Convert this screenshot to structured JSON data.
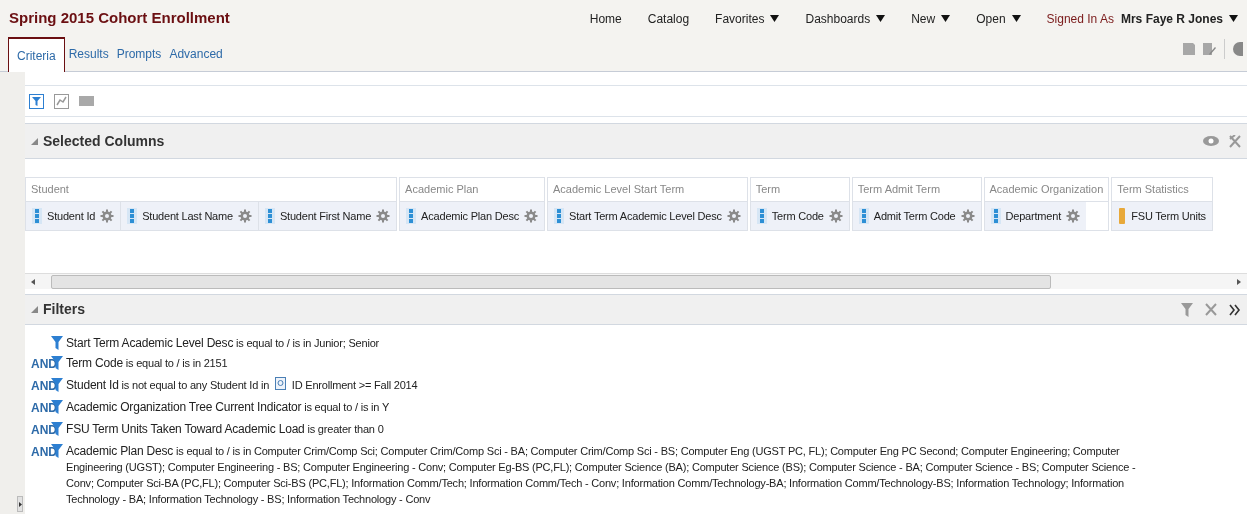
{
  "header": {
    "title": "Spring 2015 Cohort Enrollment",
    "nav": [
      {
        "label": "Home",
        "has_menu": false
      },
      {
        "label": "Catalog",
        "has_menu": false
      },
      {
        "label": "Favorites",
        "has_menu": true
      },
      {
        "label": "Dashboards",
        "has_menu": true
      },
      {
        "label": "New",
        "has_menu": true
      },
      {
        "label": "Open",
        "has_menu": true
      }
    ],
    "signed_in_label": "Signed In As",
    "user": "Mrs Faye R Jones"
  },
  "tabs": [
    {
      "label": "Criteria",
      "selected": true
    },
    {
      "label": "Results",
      "selected": false
    },
    {
      "label": "Prompts",
      "selected": false
    },
    {
      "label": "Advanced",
      "selected": false
    }
  ],
  "selected_columns": {
    "title": "Selected Columns",
    "expanded": true,
    "groups": [
      {
        "name": "Student",
        "columns": [
          {
            "name": "Student Id",
            "kind": "attribute"
          },
          {
            "name": "Student Last Name",
            "kind": "attribute"
          },
          {
            "name": "Student First Name",
            "kind": "attribute"
          }
        ]
      },
      {
        "name": "Academic Plan",
        "columns": [
          {
            "name": "Academic Plan Desc",
            "kind": "attribute"
          }
        ]
      },
      {
        "name": "Academic Level Start Term",
        "columns": [
          {
            "name": "Start Term Academic Level Desc",
            "kind": "attribute"
          }
        ]
      },
      {
        "name": "Term",
        "columns": [
          {
            "name": "Term Code",
            "kind": "attribute"
          }
        ]
      },
      {
        "name": "Term Admit Term",
        "columns": [
          {
            "name": "Admit Term Code",
            "kind": "attribute"
          }
        ]
      },
      {
        "name": "Academic Organization",
        "columns": [
          {
            "name": "Department",
            "kind": "attribute"
          }
        ]
      },
      {
        "name": "Term Statistics",
        "columns": [
          {
            "name": "FSU Term Units",
            "kind": "measure"
          }
        ]
      }
    ]
  },
  "filters": {
    "title": "Filters",
    "expanded": true,
    "items": [
      {
        "column": "Start Term Academic Level Desc",
        "operator": "is equal to / is in",
        "value": "Junior; Senior"
      },
      {
        "connector": "AND",
        "column": "Term Code",
        "operator": "is equal to / is in",
        "value": "2151"
      },
      {
        "connector": "AND",
        "column": "Student Id",
        "operator": "is not equal to any",
        "value": "Student Id in",
        "request": "ID Enrollment >= Fall 2014"
      },
      {
        "connector": "AND",
        "column": "Academic Organization Tree Current Indicator",
        "operator": "is equal to / is in",
        "value": "Y"
      },
      {
        "connector": "AND",
        "column": "FSU Term Units Taken Toward Academic Load",
        "operator": "is greater than",
        "value": "0"
      },
      {
        "connector": "AND",
        "column": "Academic Plan Desc",
        "operator": "is equal to / is in",
        "value": "Computer Crim/Comp Sci; Computer Crim/Comp Sci - BA; Computer Crim/Comp Sci - BS; Computer Eng (UGST PC, FL); Computer Eng PC Second; Computer Engineering; Computer Engineering (UGST); Computer Engineering - BS; Computer Engineering - Conv; Computer Eg-BS (PC,FL); Computer Science (BA); Computer Science (BS); Computer Science - BA; Computer Science - BS; Computer Science - Conv; Computer Sci-BA (PC,FL); Computer Sci-BS (PC,FL); Information Comm/Tech; Information Comm/Tech - Conv; Information Comm/Technology-BA; Information Comm/Technology-BS; Information Technology; Information Technology - BA; Information Technology - BS; Information Technology - Conv"
      }
    ]
  }
}
